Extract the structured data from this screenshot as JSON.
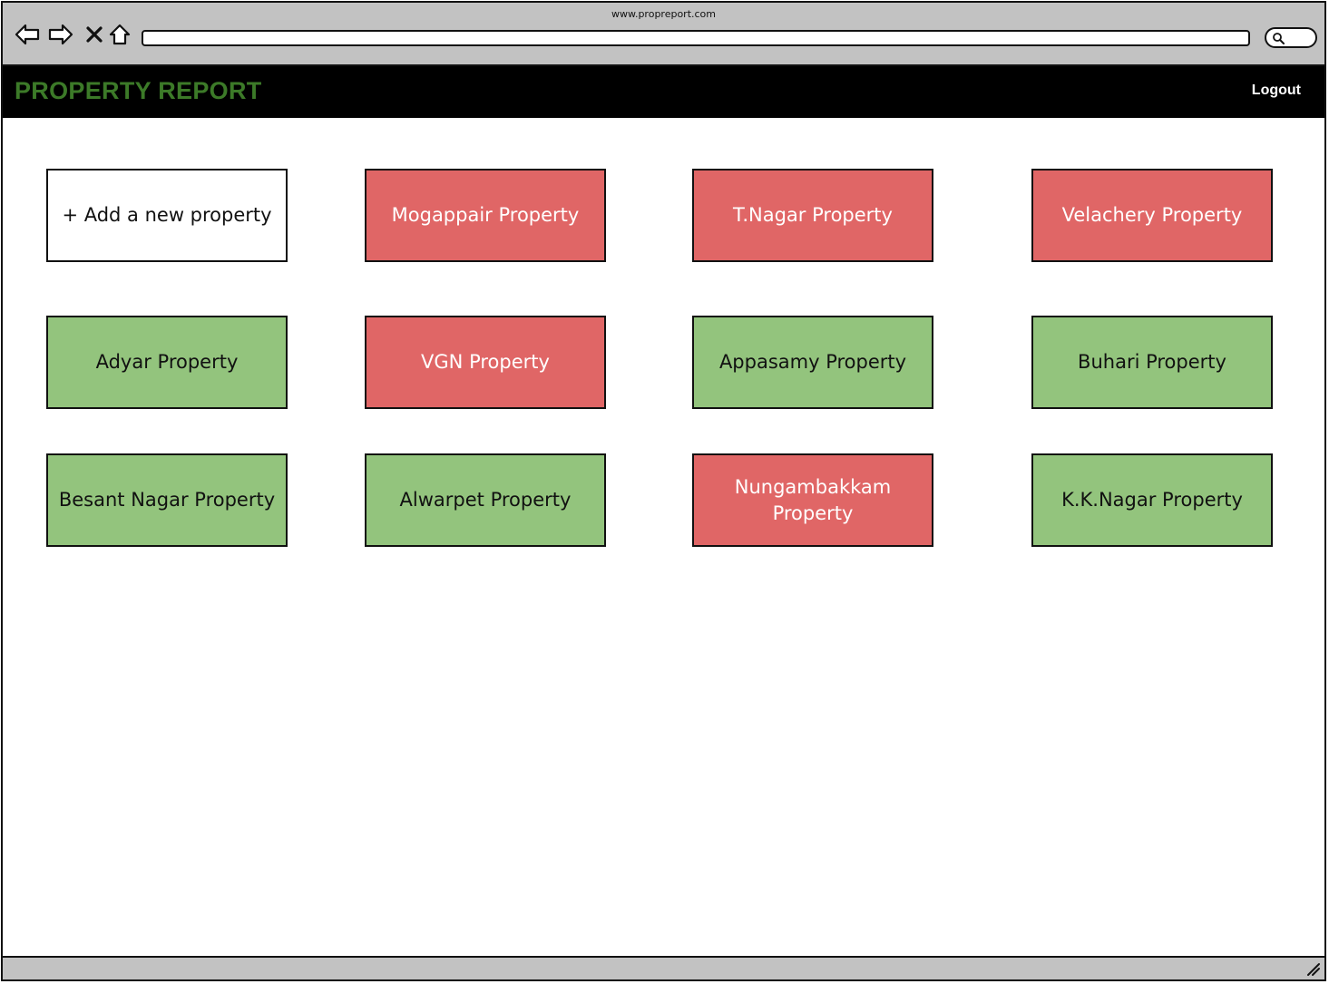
{
  "browser": {
    "url": "www.propreport.com",
    "icons": [
      "back-arrow-icon",
      "forward-arrow-icon",
      "close-x-icon",
      "home-icon",
      "search-icon"
    ]
  },
  "header": {
    "brand": "PROPERTY REPORT",
    "logout_label": "Logout",
    "brand_color": "#3c7a28"
  },
  "colors": {
    "red": "#e06666",
    "green": "#93c47d"
  },
  "tiles": [
    {
      "label": "+ Add a new property",
      "status": "add"
    },
    {
      "label": "Mogappair Property",
      "status": "red"
    },
    {
      "label": "T.Nagar Property",
      "status": "red"
    },
    {
      "label": "Velachery Property",
      "status": "red"
    },
    {
      "label": "Adyar Property",
      "status": "green"
    },
    {
      "label": "VGN Property",
      "status": "red"
    },
    {
      "label": "Appasamy Property",
      "status": "green"
    },
    {
      "label": "Buhari Property",
      "status": "green"
    },
    {
      "label": "Besant Nagar Property",
      "status": "green"
    },
    {
      "label": "Alwarpet Property",
      "status": "green"
    },
    {
      "label": "Nungambakkam Property",
      "status": "red"
    },
    {
      "label": "K.K.Nagar Property",
      "status": "green"
    }
  ]
}
